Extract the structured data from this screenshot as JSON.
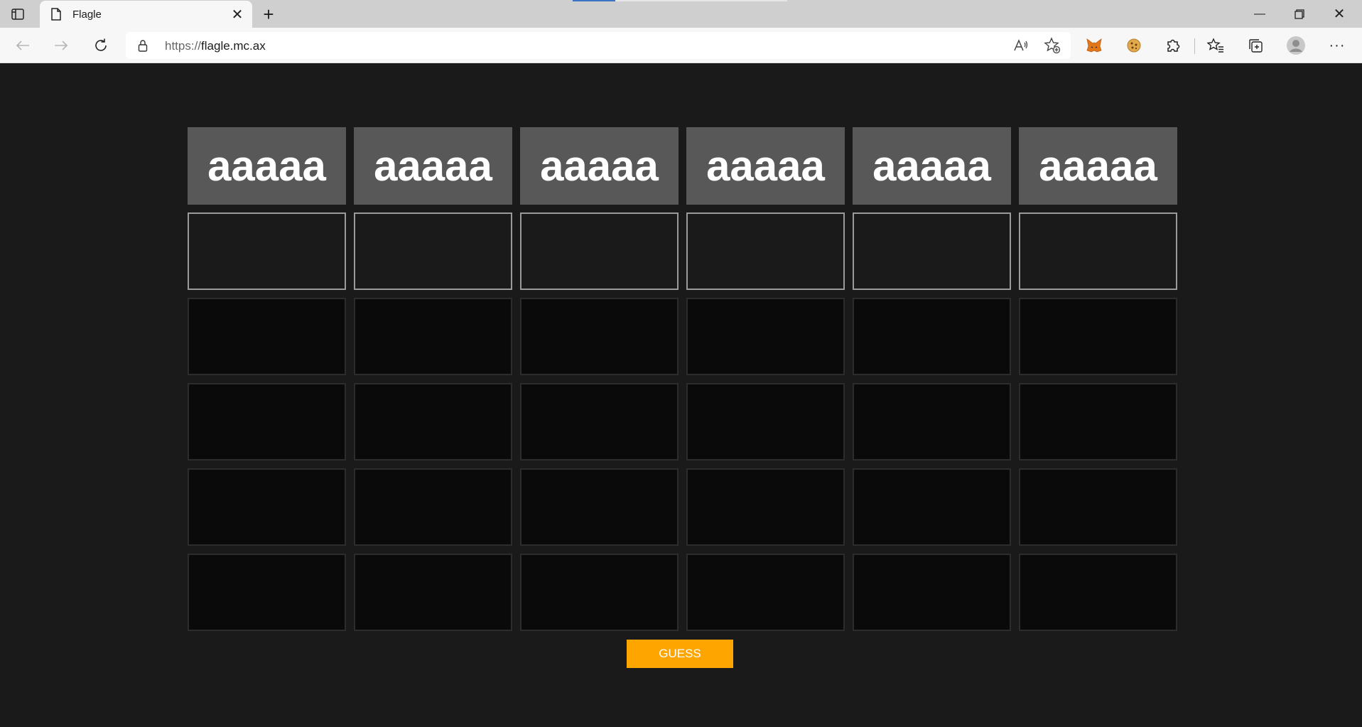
{
  "browser": {
    "tab": {
      "title": "Flagle"
    },
    "address": {
      "scheme": "https://",
      "host": "flagle.mc.ax"
    }
  },
  "game": {
    "rows": [
      [
        "aaaaa",
        "aaaaa",
        "aaaaa",
        "aaaaa",
        "aaaaa",
        "aaaaa"
      ],
      [
        "",
        "",
        "",
        "",
        "",
        ""
      ],
      [
        "",
        "",
        "",
        "",
        "",
        ""
      ],
      [
        "",
        "",
        "",
        "",
        "",
        ""
      ],
      [
        "",
        "",
        "",
        "",
        "",
        ""
      ],
      [
        "",
        "",
        "",
        "",
        "",
        ""
      ]
    ],
    "row_states": [
      "filled",
      "active",
      "empty",
      "empty",
      "empty",
      "empty"
    ],
    "guess_label": "GUESS",
    "colors": {
      "filled": "#585858",
      "active_border": "#9a9a9a",
      "empty": "#0a0a0a",
      "button": "#ffa500"
    }
  }
}
